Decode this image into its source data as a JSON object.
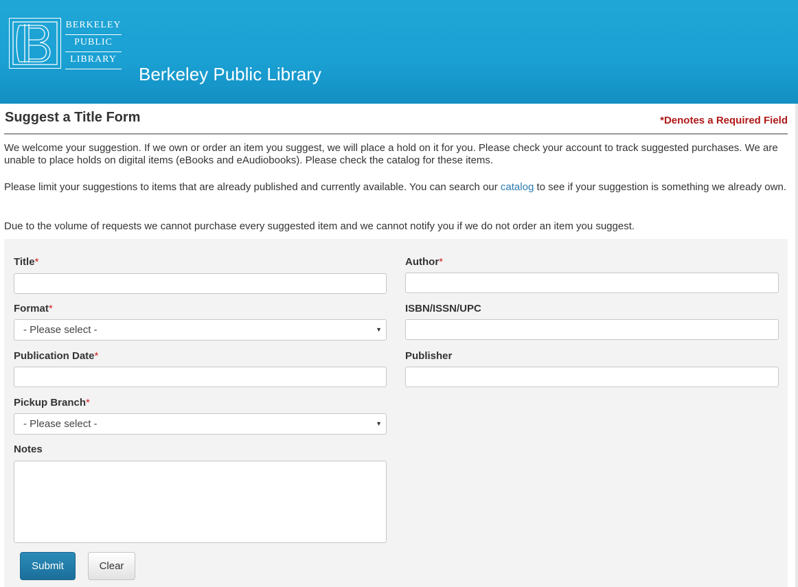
{
  "header": {
    "logo_words": [
      "BERKELEY",
      "PUBLIC",
      "LIBRARY"
    ],
    "site_title": "Berkeley Public Library"
  },
  "page": {
    "title": "Suggest a Title Form",
    "required_note": "*Denotes a Required Field",
    "intro": {
      "p1": "We welcome your suggestion. If we own or order an item you suggest, we will place a hold on it for you. Please check your account to track suggested purchases. We are unable to place holds on digital items (eBooks and eAudiobooks). Please check the catalog for these items.",
      "p2_before": "Please limit your suggestions to items that are already published and currently available. You can search our ",
      "p2_link": "catalog",
      "p2_after": " to see if your suggestion is something we already own.",
      "p3": "Due to the volume of requests we cannot purchase every suggested item and we cannot notify you if we do not order an item you suggest."
    }
  },
  "form": {
    "required_marker": "*",
    "title_label": "Title",
    "author_label": "Author",
    "format_label": "Format",
    "format_value": "- Please select -",
    "isbn_label": "ISBN/ISSN/UPC",
    "pubdate_label": "Publication Date",
    "publisher_label": "Publisher",
    "branch_label": "Pickup Branch",
    "branch_value": "- Please select -",
    "notes_label": "Notes",
    "submit_label": "Submit",
    "clear_label": "Clear"
  },
  "icons": {
    "dropdown": "triangle-down-icon",
    "logo": "library-b-logo"
  },
  "colors": {
    "header": "#1aa0d3",
    "required": "#b01818",
    "link": "#2a7ab0",
    "submit": "#1b6f9a",
    "panel": "#f3f3f3"
  }
}
